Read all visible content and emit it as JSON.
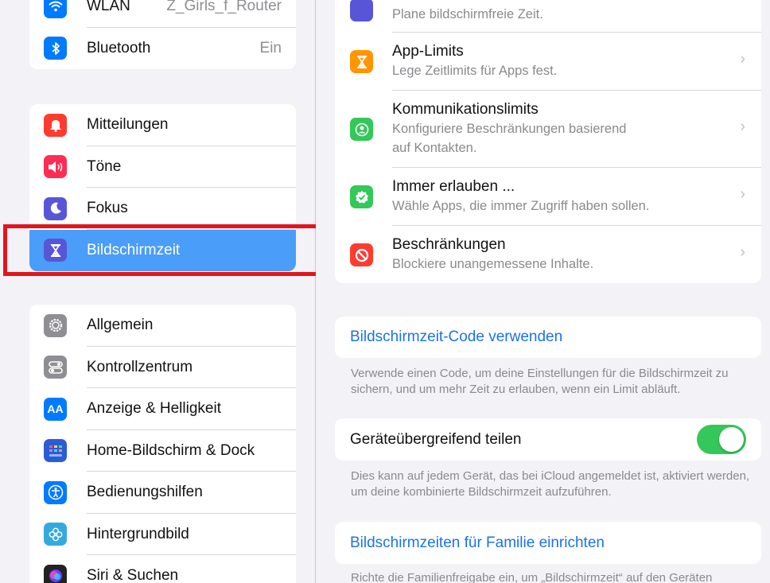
{
  "sidebar": {
    "group1": [
      {
        "label": "WLAN",
        "value": "Z_Girls_f_Router",
        "icon": "wifi-icon",
        "color": "#007aff"
      },
      {
        "label": "Bluetooth",
        "value": "Ein",
        "icon": "bluetooth-icon",
        "color": "#007aff"
      }
    ],
    "group2": [
      {
        "label": "Mitteilungen",
        "icon": "bell-icon",
        "color": "#ff3b30"
      },
      {
        "label": "Töne",
        "icon": "speaker-icon",
        "color": "#ff2d55"
      },
      {
        "label": "Fokus",
        "icon": "moon-icon",
        "color": "#5856d6"
      },
      {
        "label": "Bildschirmzeit",
        "icon": "hourglass-icon",
        "color": "#5856d6",
        "selected": true
      }
    ],
    "group3": [
      {
        "label": "Allgemein",
        "icon": "gear-icon",
        "color": "#8e8e93"
      },
      {
        "label": "Kontrollzentrum",
        "icon": "toggles-icon",
        "color": "#8e8e93"
      },
      {
        "label": "Anzeige & Helligkeit",
        "icon": "text-size-icon",
        "color": "#007aff"
      },
      {
        "label": "Home-Bildschirm & Dock",
        "icon": "app-grid-icon",
        "color": "#2c5bd6"
      },
      {
        "label": "Bedienungshilfen",
        "icon": "accessibility-icon",
        "color": "#007aff"
      },
      {
        "label": "Hintergrundbild",
        "icon": "flower-icon",
        "color": "#34aadc"
      },
      {
        "label": "Siri & Suchen",
        "icon": "siri-icon",
        "color": "#222222"
      }
    ]
  },
  "content": {
    "top_partial_subtitle": "Plane bildschirmfreie Zeit.",
    "items": [
      {
        "title": "App-Limits",
        "subtitle": "Lege Zeitlimits für Apps fest.",
        "icon": "hourglass-icon",
        "color": "#ff9500"
      },
      {
        "title": "Kommunikationslimits",
        "subtitle": "Konfiguriere Beschränkungen basierend",
        "subtitle2": "auf Kontakten.",
        "icon": "contact-icon",
        "color": "#34c759"
      },
      {
        "title": "Immer erlauben ...",
        "subtitle": "Wähle Apps, die immer Zugriff haben sollen.",
        "icon": "checkmark-badge-icon",
        "color": "#34c759"
      },
      {
        "title": "Beschränkungen",
        "subtitle": "Blockiere unangemessene Inhalte.",
        "icon": "no-entry-icon",
        "color": "#ff3b30"
      }
    ],
    "passcode_link": "Bildschirmzeit-Code verwenden",
    "passcode_note": "Verwende einen Code, um deine Einstellungen für die Bildschirmzeit zu sichern, und um mehr Zeit zu erlauben, wenn ein Limit abläuft.",
    "share_label": "Geräteübergreifend teilen",
    "share_on": true,
    "share_note": "Dies kann auf jedem Gerät, das bei iCloud angemeldet ist, aktiviert werden, um deine kombinierte Bildschirmzeit aufzuführen.",
    "family_link": "Bildschirmzeiten für Familie einrichten",
    "family_note": "Richte die Familienfreigabe ein, um „Bildschirmzeit“ auf den Geräten"
  },
  "colors": {
    "accent": "#1a73e8",
    "selected_bg": "#4a9df8",
    "highlight_border": "#e3141b",
    "toggle_on": "#34c759"
  }
}
